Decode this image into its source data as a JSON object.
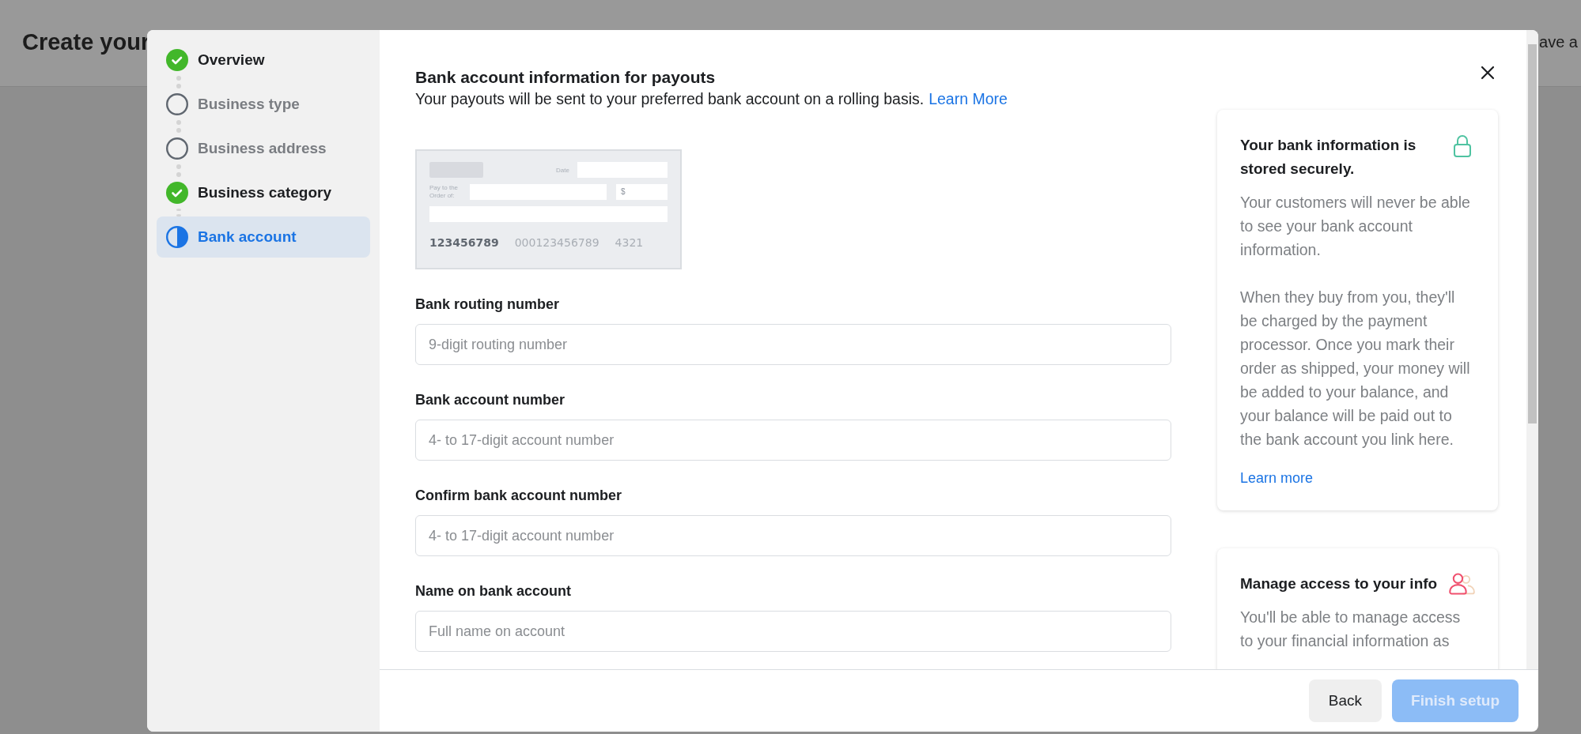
{
  "page_header": {
    "title": "Create your",
    "right_text": "ave a"
  },
  "steps": [
    {
      "label": "Overview",
      "completed": true,
      "selected": false
    },
    {
      "label": "Business type",
      "completed": false,
      "selected": false
    },
    {
      "label": "Business address",
      "completed": false,
      "selected": false
    },
    {
      "label": "Business category",
      "completed": true,
      "selected": false
    },
    {
      "label": "Bank account",
      "completed": false,
      "selected": true
    }
  ],
  "dialog": {
    "title": "Bank account information for payouts",
    "subtitle": "Your payouts will be sent to your preferred bank account on a rolling basis.",
    "subtitle_link": "Learn More",
    "check_image": {
      "date_label": "Date",
      "payee_label": "Pay to the Order of:",
      "amount_symbol": "$",
      "routing": "123456789",
      "account": "000123456789",
      "check_number": "4321"
    },
    "fields": [
      {
        "label": "Bank routing number",
        "placeholder": "9-digit routing number"
      },
      {
        "label": "Bank account number",
        "placeholder": "4- to 17-digit account number"
      },
      {
        "label": "Confirm bank account number",
        "placeholder": "4- to 17-digit account number"
      },
      {
        "label": "Name on bank account",
        "placeholder": "Full name on account"
      }
    ],
    "info_cards": [
      {
        "title": "Your bank information is stored securely.",
        "paragraphs": [
          "Your customers will never be able to see your bank account information.",
          "When they buy from you, they'll be charged by the payment processor. Once you mark their order as shipped, your money will be added to your balance, and your balance will be paid out to the bank account you link here."
        ],
        "link": "Learn more"
      },
      {
        "title": "Manage access to your info",
        "paragraphs": [
          "You'll be able to manage access to your financial information as"
        ]
      }
    ],
    "buttons": [
      {
        "label": "Back",
        "kind": "secondary",
        "disabled": false
      },
      {
        "label": "Finish setup",
        "kind": "primary",
        "disabled": true
      }
    ]
  }
}
